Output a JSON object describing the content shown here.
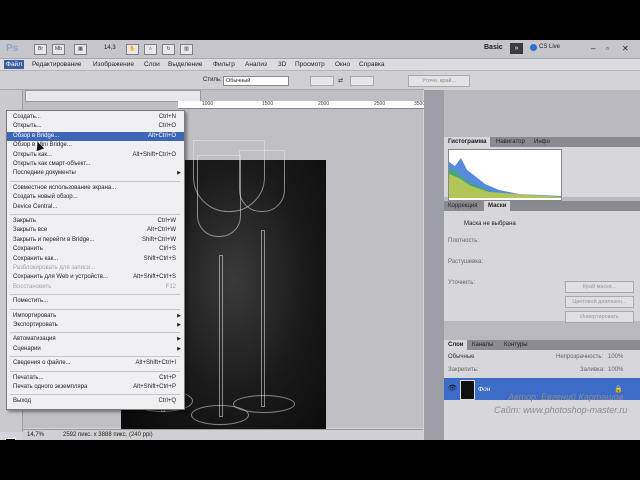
{
  "app": {
    "logo": "Ps",
    "zoom": "14,3",
    "workspace": "Basic",
    "cs_live": "CS Live"
  },
  "menubar": [
    "Файл",
    "Редактирование",
    "Изображение",
    "Слои",
    "Выделение",
    "Фильтр",
    "Анализ",
    "3D",
    "Просмотр",
    "Окно",
    "Справка"
  ],
  "options": {
    "styles_label": "Стиль:",
    "styles_value": "Обычный",
    "refine_button": "Уточн. край..."
  },
  "rulers": [
    "1000",
    "1500",
    "2000",
    "2500",
    "3500"
  ],
  "file_menu": [
    {
      "label": "Создать...",
      "shortcut": "Ctrl+N"
    },
    {
      "label": "Открыть...",
      "shortcut": "Ctrl+O"
    },
    {
      "label": "Обзор в Bridge...",
      "shortcut": "Alt+Ctrl+O",
      "highlight": true
    },
    {
      "label": "Обзор в Mini Bridge...",
      "shortcut": ""
    },
    {
      "label": "Открыть как...",
      "shortcut": "Alt+Shift+Ctrl+O"
    },
    {
      "label": "Открыть как смарт-объект...",
      "shortcut": ""
    },
    {
      "label": "Последние документы",
      "shortcut": "",
      "submenu": true
    },
    {
      "sep": true
    },
    {
      "label": "Совместное использование экрана...",
      "shortcut": ""
    },
    {
      "label": "Создать новый обзор...",
      "shortcut": ""
    },
    {
      "label": "Device Central...",
      "shortcut": ""
    },
    {
      "sep": true
    },
    {
      "label": "Закрыть",
      "shortcut": "Ctrl+W"
    },
    {
      "label": "Закрыть все",
      "shortcut": "Alt+Ctrl+W"
    },
    {
      "label": "Закрыть и перейти в Bridge...",
      "shortcut": "Shift+Ctrl+W"
    },
    {
      "label": "Сохранить",
      "shortcut": "Ctrl+S"
    },
    {
      "label": "Сохранить как...",
      "shortcut": "Shift+Ctrl+S"
    },
    {
      "label": "Разблокировать для записи...",
      "shortcut": "",
      "disabled": true
    },
    {
      "label": "Сохранить для Web и устройств...",
      "shortcut": "Alt+Shift+Ctrl+S"
    },
    {
      "label": "Восстановить",
      "shortcut": "F12",
      "disabled": true
    },
    {
      "sep": true
    },
    {
      "label": "Поместить...",
      "shortcut": ""
    },
    {
      "sep": true
    },
    {
      "label": "Импортировать",
      "shortcut": "",
      "submenu": true
    },
    {
      "label": "Экспортировать",
      "shortcut": "",
      "submenu": true
    },
    {
      "sep": true
    },
    {
      "label": "Автоматизация",
      "shortcut": "",
      "submenu": true
    },
    {
      "label": "Сценарии",
      "shortcut": "",
      "submenu": true
    },
    {
      "sep": true
    },
    {
      "label": "Сведения о файле...",
      "shortcut": "Alt+Shift+Ctrl+I"
    },
    {
      "sep": true
    },
    {
      "label": "Печатать...",
      "shortcut": "Ctrl+P"
    },
    {
      "label": "Печать одного экземпляра",
      "shortcut": "Alt+Shift+Ctrl+P"
    },
    {
      "sep": true
    },
    {
      "label": "Выход",
      "shortcut": "Ctrl+Q"
    }
  ],
  "status": {
    "zoom": "14,7%",
    "doc": "2592 пикс. x 3888 пикс. (240 ppi)"
  },
  "panels": {
    "hist_tabs": [
      "Гистограмма",
      "Навигатор",
      "Инфо"
    ],
    "mask_tabs": [
      "Коррекция",
      "Маски"
    ],
    "mask_title": "Маска не выбрана",
    "density": "Плотность:",
    "feather": "Растушевка:",
    "refine": "Уточнить:",
    "mask_buttons": [
      "Край маски...",
      "Цветовой диапазон...",
      "Инвертировать"
    ],
    "layer_tabs": [
      "Слои",
      "Каналы",
      "Контуры"
    ],
    "blend": "Обычные",
    "opacity": "Непрозрачность:",
    "opacity_val": "100%",
    "lock": "Закрепить:",
    "fill": "Заливка:",
    "fill_val": "100%",
    "layer_name": "Фон"
  },
  "watermark": {
    "author": "Автор: Евгений Карташов",
    "site": "Сайт: www.photoshop-master.ru"
  }
}
